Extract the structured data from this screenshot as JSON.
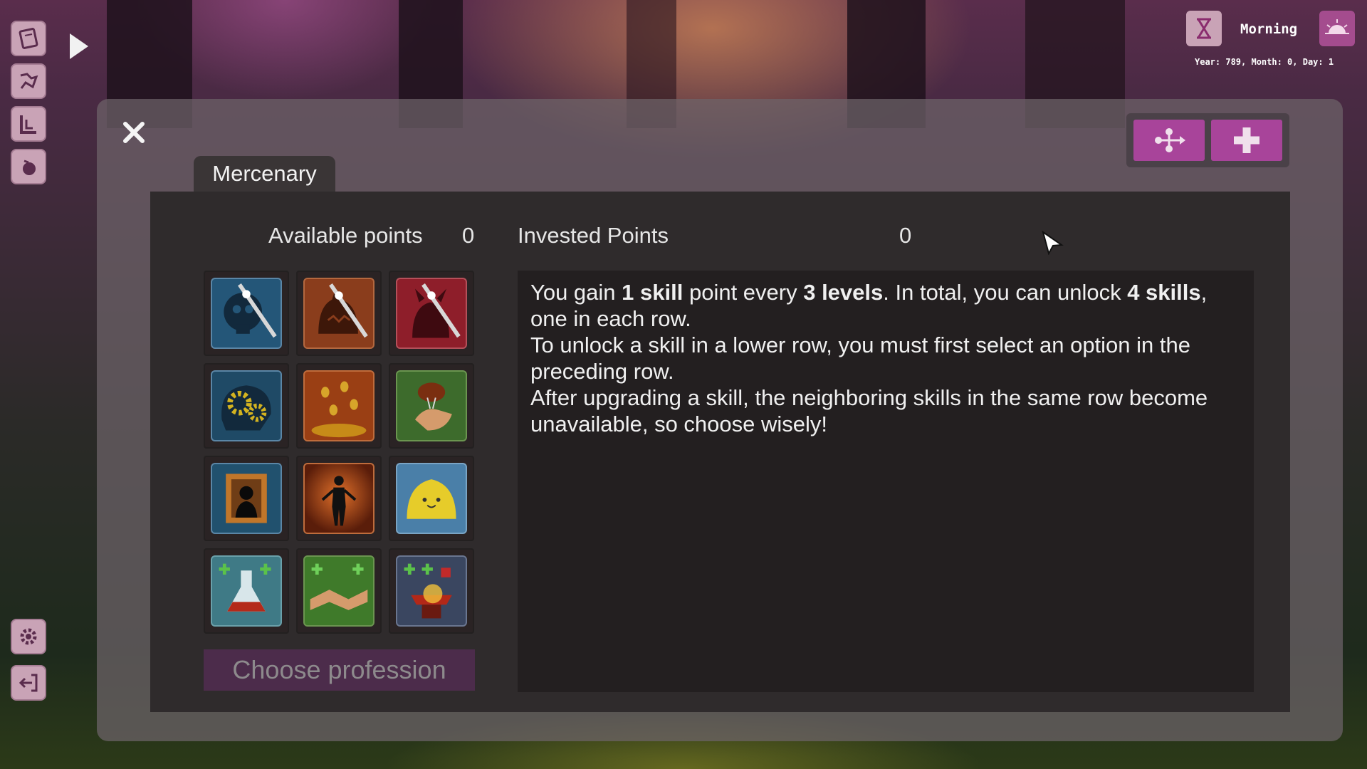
{
  "hud": {
    "time_of_day": "Morning",
    "date": "Year: 789, Month: 0, Day: 1"
  },
  "sidebar": {
    "top_items": [
      "journal-icon",
      "map-icon",
      "stats-icon",
      "inventory-icon"
    ],
    "bottom_items": [
      "settings-icon",
      "exit-icon"
    ]
  },
  "panel": {
    "tab_label": "Mercenary",
    "available_points_label": "Available points",
    "available_points_value": "0",
    "invested_points_label": "Invested Points",
    "invested_points_value": "0",
    "choose_button": "Choose profession",
    "description": {
      "line1_a": "You gain ",
      "line1_b": "1 skill",
      "line1_c": " point every ",
      "line1_d": "3 levels",
      "line1_e": ". In total, you can unlock ",
      "line1_f": "4 skills",
      "line1_g": ", one in each row.",
      "line2": "To unlock a skill in a lower row, you must first select an option in the preceding row.",
      "line3": "After upgrading a skill, the neighboring skills in the same row become unavailable, so choose wisely!"
    },
    "skills": [
      [
        "skull-sword-skill-icon",
        "beast-sword-skill-icon",
        "demon-sword-skill-icon"
      ],
      [
        "gears-mind-skill-icon",
        "coins-skill-icon",
        "money-bag-skill-icon"
      ],
      [
        "portrait-skill-icon",
        "silhouette-skill-icon",
        "slime-skill-icon"
      ],
      [
        "potion-plus-skill-icon",
        "handshake-plus-skill-icon",
        "anvil-plus-skill-icon"
      ]
    ]
  },
  "colors": {
    "accent": "#a8449a",
    "sidebar_button": "#c9a3b6",
    "panel_bg": "#2f2b2c"
  }
}
